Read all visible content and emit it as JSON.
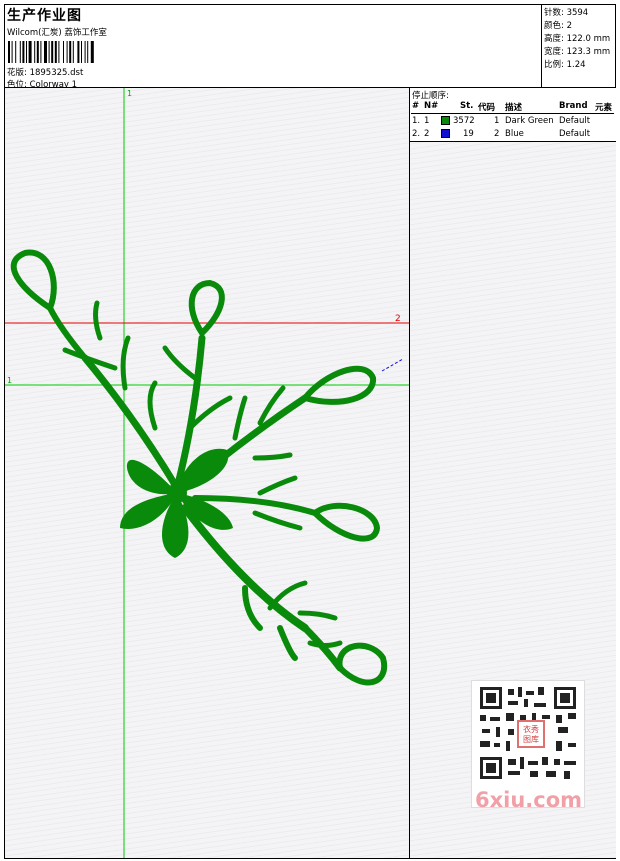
{
  "header": {
    "title": "生产作业图",
    "company": "Wilcom(汇炭) 荔饰工作室",
    "design_label": "花版:",
    "design_file": "1895325.dst",
    "color_label": "色位:",
    "colorway": "Colorway 1"
  },
  "stats": [
    {
      "label": "针数:",
      "value": "3594"
    },
    {
      "label": "颜色:",
      "value": "2"
    },
    {
      "label": "高度:",
      "value": "122.0 mm"
    },
    {
      "label": "宽度:",
      "value": "123.3 mm"
    },
    {
      "label": "比例:",
      "value": "1.24"
    }
  ],
  "stop_sequence": {
    "title": "停止顺序:",
    "headers": {
      "hash": "#",
      "needle": "N#",
      "stitches": "St.",
      "code": "代码",
      "description": "描述",
      "brand": "Brand",
      "element": "元素"
    },
    "rows": [
      {
        "index": "1.",
        "needle": "1",
        "color": "#0a8a0a",
        "stitches": "3572",
        "code": "1",
        "description": "Dark Green",
        "brand": "Default"
      },
      {
        "index": "2.",
        "needle": "2",
        "color": "#1010d0",
        "stitches": "19",
        "code": "2",
        "description": "Blue",
        "brand": "Default"
      }
    ]
  },
  "guides": {
    "vertical_label": "1",
    "horizontal1_label": "1",
    "horizontal2_label": "2"
  },
  "colors": {
    "embroidery_green": "#0a8a0a",
    "guide_green": "#00cc00",
    "guide_red": "#e00000",
    "blue_stitch": "#1010d0"
  },
  "watermark": {
    "text": "6xiu.com",
    "seal_text": "衣秀图库"
  }
}
